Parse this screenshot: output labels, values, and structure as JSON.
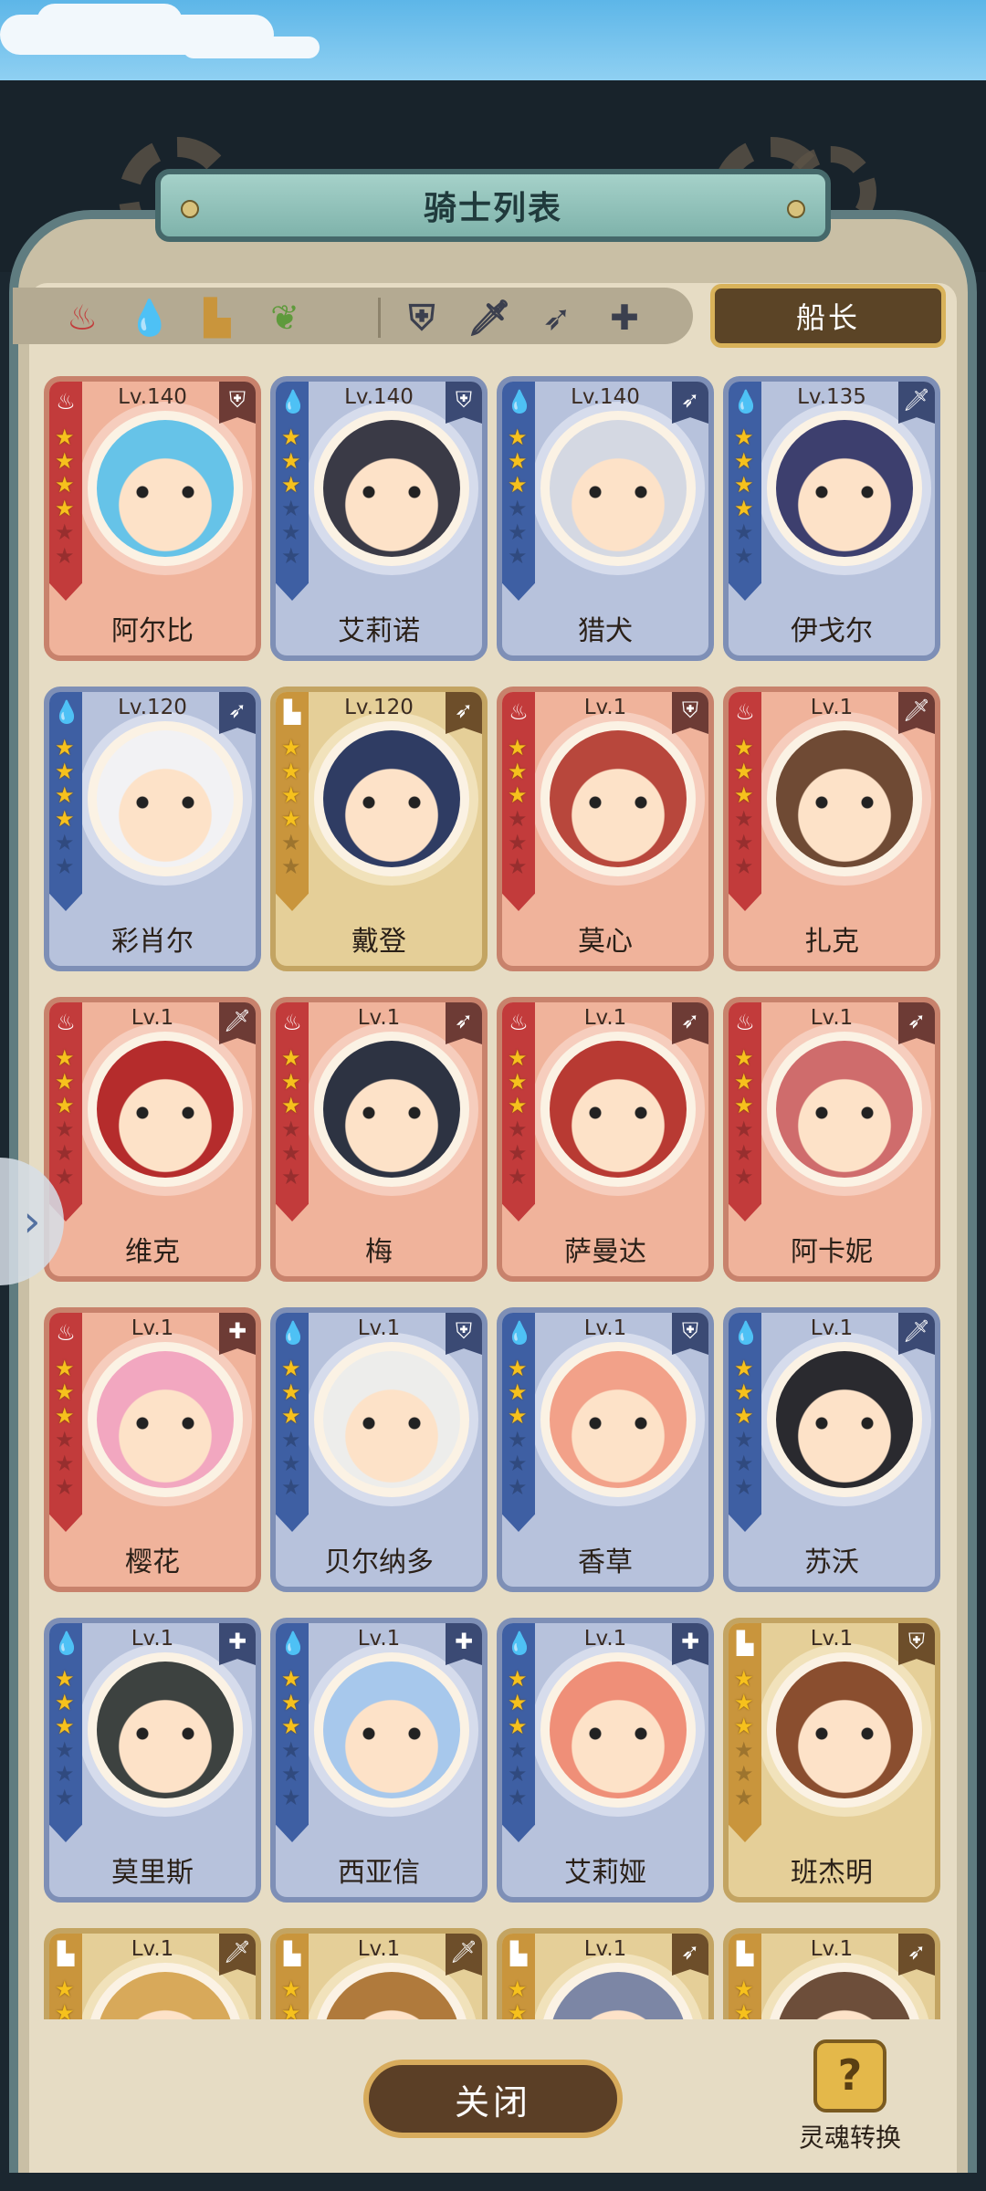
{
  "header": {
    "title": "骑士列表",
    "captain_label": "船长"
  },
  "filters": {
    "elements": [
      {
        "icon": "fire-element-icon",
        "glyph": "♨",
        "color": "#c23b3b"
      },
      {
        "icon": "water-element-icon",
        "glyph": "💧",
        "color": "#3e6fc0"
      },
      {
        "icon": "earth-element-icon",
        "glyph": "▙",
        "color": "#c9953c"
      },
      {
        "icon": "wind-element-icon",
        "glyph": "❦",
        "color": "#5f9a3c"
      }
    ],
    "classes": [
      {
        "icon": "shield-class-icon",
        "glyph": "⛨"
      },
      {
        "icon": "sword-class-icon",
        "glyph": "🗡"
      },
      {
        "icon": "bow-class-icon",
        "glyph": "➶"
      },
      {
        "icon": "support-class-icon",
        "glyph": "✚"
      }
    ]
  },
  "cards": [
    {
      "name": "阿尔比",
      "level": "Lv.140",
      "element": "fire",
      "class_icon": "⛨",
      "stars": 4,
      "face": "#66c3e8"
    },
    {
      "name": "艾莉诺",
      "level": "Lv.140",
      "element": "water",
      "class_icon": "⛨",
      "stars": 3,
      "face": "#3a3a46"
    },
    {
      "name": "猎犬",
      "level": "Lv.140",
      "element": "water",
      "class_icon": "➶",
      "stars": 3,
      "face": "#d4d8e2"
    },
    {
      "name": "伊戈尔",
      "level": "Lv.135",
      "element": "water",
      "class_icon": "🗡",
      "stars": 4,
      "face": "#3d3f6e"
    },
    {
      "name": "彩肖尔",
      "level": "Lv.120",
      "element": "water",
      "class_icon": "➶",
      "stars": 4,
      "face": "#f2f2f4"
    },
    {
      "name": "戴登",
      "level": "Lv.120",
      "element": "earth",
      "class_icon": "➶",
      "stars": 4,
      "face": "#2f3c63"
    },
    {
      "name": "莫心",
      "level": "Lv.1",
      "element": "fire",
      "class_icon": "⛨",
      "stars": 3,
      "face": "#b8473c"
    },
    {
      "name": "扎克",
      "level": "Lv.1",
      "element": "fire",
      "class_icon": "🗡",
      "stars": 3,
      "face": "#6f4a34"
    },
    {
      "name": "维克",
      "level": "Lv.1",
      "element": "fire",
      "class_icon": "🗡",
      "stars": 3,
      "face": "#b52c2c"
    },
    {
      "name": "梅",
      "level": "Lv.1",
      "element": "fire",
      "class_icon": "➶",
      "stars": 3,
      "face": "#2d3342"
    },
    {
      "name": "萨曼达",
      "level": "Lv.1",
      "element": "fire",
      "class_icon": "➶",
      "stars": 3,
      "face": "#b83a33"
    },
    {
      "name": "阿卡妮",
      "level": "Lv.1",
      "element": "fire",
      "class_icon": "➶",
      "stars": 3,
      "face": "#cf6c6c"
    },
    {
      "name": "樱花",
      "level": "Lv.1",
      "element": "fire",
      "class_icon": "✚",
      "stars": 3,
      "face": "#f2a7c0"
    },
    {
      "name": "贝尔纳多",
      "level": "Lv.1",
      "element": "water",
      "class_icon": "⛨",
      "stars": 3,
      "face": "#ededeb"
    },
    {
      "name": "香草",
      "level": "Lv.1",
      "element": "water",
      "class_icon": "⛨",
      "stars": 3,
      "face": "#f2a189"
    },
    {
      "name": "苏沃",
      "level": "Lv.1",
      "element": "water",
      "class_icon": "🗡",
      "stars": 3,
      "face": "#2a2a2f"
    },
    {
      "name": "莫里斯",
      "level": "Lv.1",
      "element": "water",
      "class_icon": "✚",
      "stars": 3,
      "face": "#3d4240"
    },
    {
      "name": "西亚信",
      "level": "Lv.1",
      "element": "water",
      "class_icon": "✚",
      "stars": 3,
      "face": "#a7c8ec"
    },
    {
      "name": "艾莉娅",
      "level": "Lv.1",
      "element": "water",
      "class_icon": "✚",
      "stars": 3,
      "face": "#ef8f78"
    },
    {
      "name": "班杰明",
      "level": "Lv.1",
      "element": "earth",
      "class_icon": "⛨",
      "stars": 3,
      "face": "#8a4e2f"
    },
    {
      "name": "",
      "level": "Lv.1",
      "element": "earth",
      "class_icon": "🗡",
      "stars": 3,
      "face": "#d8a95a"
    },
    {
      "name": "",
      "level": "Lv.1",
      "element": "earth",
      "class_icon": "🗡",
      "stars": 3,
      "face": "#b07a3c"
    },
    {
      "name": "",
      "level": "Lv.1",
      "element": "earth",
      "class_icon": "➶",
      "stars": 3,
      "face": "#7c86a5"
    },
    {
      "name": "",
      "level": "Lv.1",
      "element": "earth",
      "class_icon": "➶",
      "stars": 3,
      "face": "#6d4e3a"
    }
  ],
  "footer": {
    "close_label": "关闭",
    "soul_convert_label": "灵魂转换",
    "soul_icon": "?"
  },
  "side_tab_icon": "›"
}
